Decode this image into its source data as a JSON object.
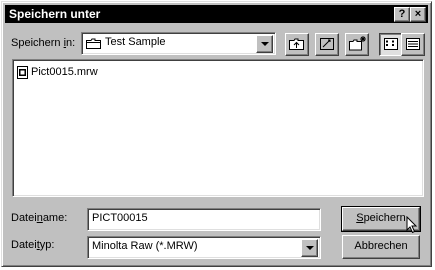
{
  "window": {
    "title": "Speichern unter",
    "help_label": "?",
    "close_label": "×"
  },
  "save_in": {
    "label_pre": "Speichern ",
    "label_u": "i",
    "label_post": "n:",
    "value": "Test Sample"
  },
  "files": [
    {
      "name": "Pict0015.mrw"
    }
  ],
  "filename": {
    "label_pre": "Datei",
    "label_u": "n",
    "label_post": "ame:",
    "value": "PICT00015"
  },
  "filetype": {
    "label_pre": "Datei",
    "label_u": "t",
    "label_post": "yp:",
    "value": "Minolta Raw (*.MRW)"
  },
  "buttons": {
    "save_u": "S",
    "save_rest": "peichern",
    "cancel": "Abbrechen"
  }
}
